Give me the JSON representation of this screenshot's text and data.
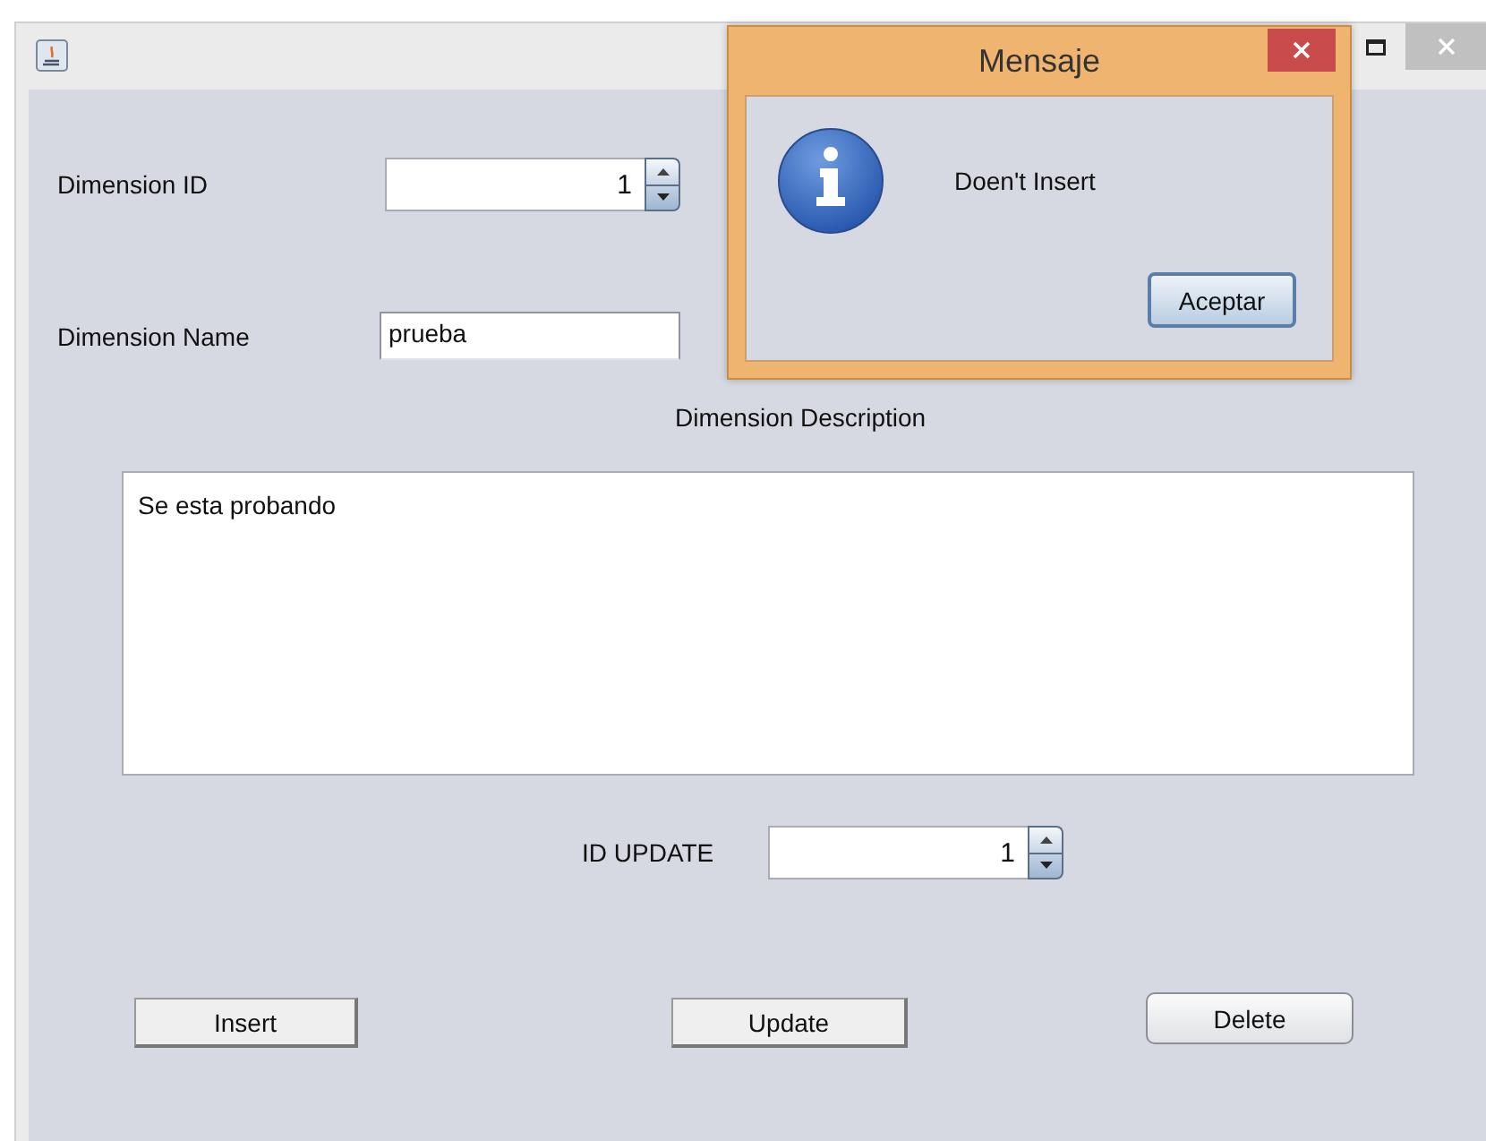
{
  "form": {
    "fields": [
      {
        "kind": "spinner",
        "label": "Dimension ID",
        "value": "1"
      },
      {
        "kind": "text",
        "label": "Dimension Name",
        "value": "prueba"
      }
    ],
    "description": {
      "label": "Dimension Description",
      "value": "Se esta probando"
    },
    "update": {
      "label": "ID UPDATE",
      "value": "1"
    },
    "buttons": [
      {
        "label": "Insert",
        "focused": false
      },
      {
        "label": "Update",
        "focused": false
      },
      {
        "label": "Delete",
        "focused": true
      }
    ]
  },
  "dialog": {
    "title": "Mensaje",
    "message": "Doen't Insert",
    "button": "Aceptar"
  }
}
